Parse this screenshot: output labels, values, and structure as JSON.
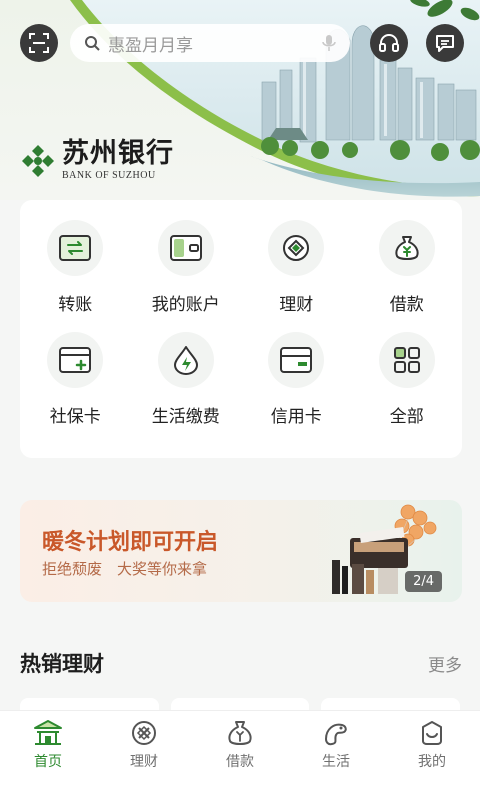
{
  "header": {
    "search_placeholder": "惠盈月月享",
    "scan_icon": "scan-icon",
    "voice_icon": "mic-icon",
    "support_icon": "headset-icon",
    "message_icon": "chat-icon"
  },
  "brand": {
    "name_cn": "苏州银行",
    "name_en": "BANK OF SUZHOU",
    "logo_icon": "bank-logo-icon"
  },
  "quick_actions": [
    {
      "label": "转账",
      "icon": "transfer-icon"
    },
    {
      "label": "我的账户",
      "icon": "wallet-icon"
    },
    {
      "label": "理财",
      "icon": "wealth-icon"
    },
    {
      "label": "借款",
      "icon": "money-bag-icon"
    },
    {
      "label": "社保卡",
      "icon": "social-card-icon"
    },
    {
      "label": "生活缴费",
      "icon": "utility-drop-icon"
    },
    {
      "label": "信用卡",
      "icon": "credit-card-icon"
    },
    {
      "label": "全部",
      "icon": "grid-all-icon"
    }
  ],
  "banner": {
    "title": "暖冬计划即可开启",
    "subtitle": "拒绝颓废　大奖等你来拿",
    "page_indicator": "2/4"
  },
  "section": {
    "title": "热销理财",
    "more": "更多"
  },
  "tabbar": [
    {
      "label": "首页",
      "icon": "home-pavilion-icon",
      "active": true
    },
    {
      "label": "理财",
      "icon": "wealth-tab-icon",
      "active": false
    },
    {
      "label": "借款",
      "icon": "loan-tab-icon",
      "active": false
    },
    {
      "label": "生活",
      "icon": "life-tab-icon",
      "active": false
    },
    {
      "label": "我的",
      "icon": "profile-tab-icon",
      "active": false
    }
  ],
  "colors": {
    "brand_green": "#2d8a2f",
    "banner_title": "#c9582a"
  }
}
